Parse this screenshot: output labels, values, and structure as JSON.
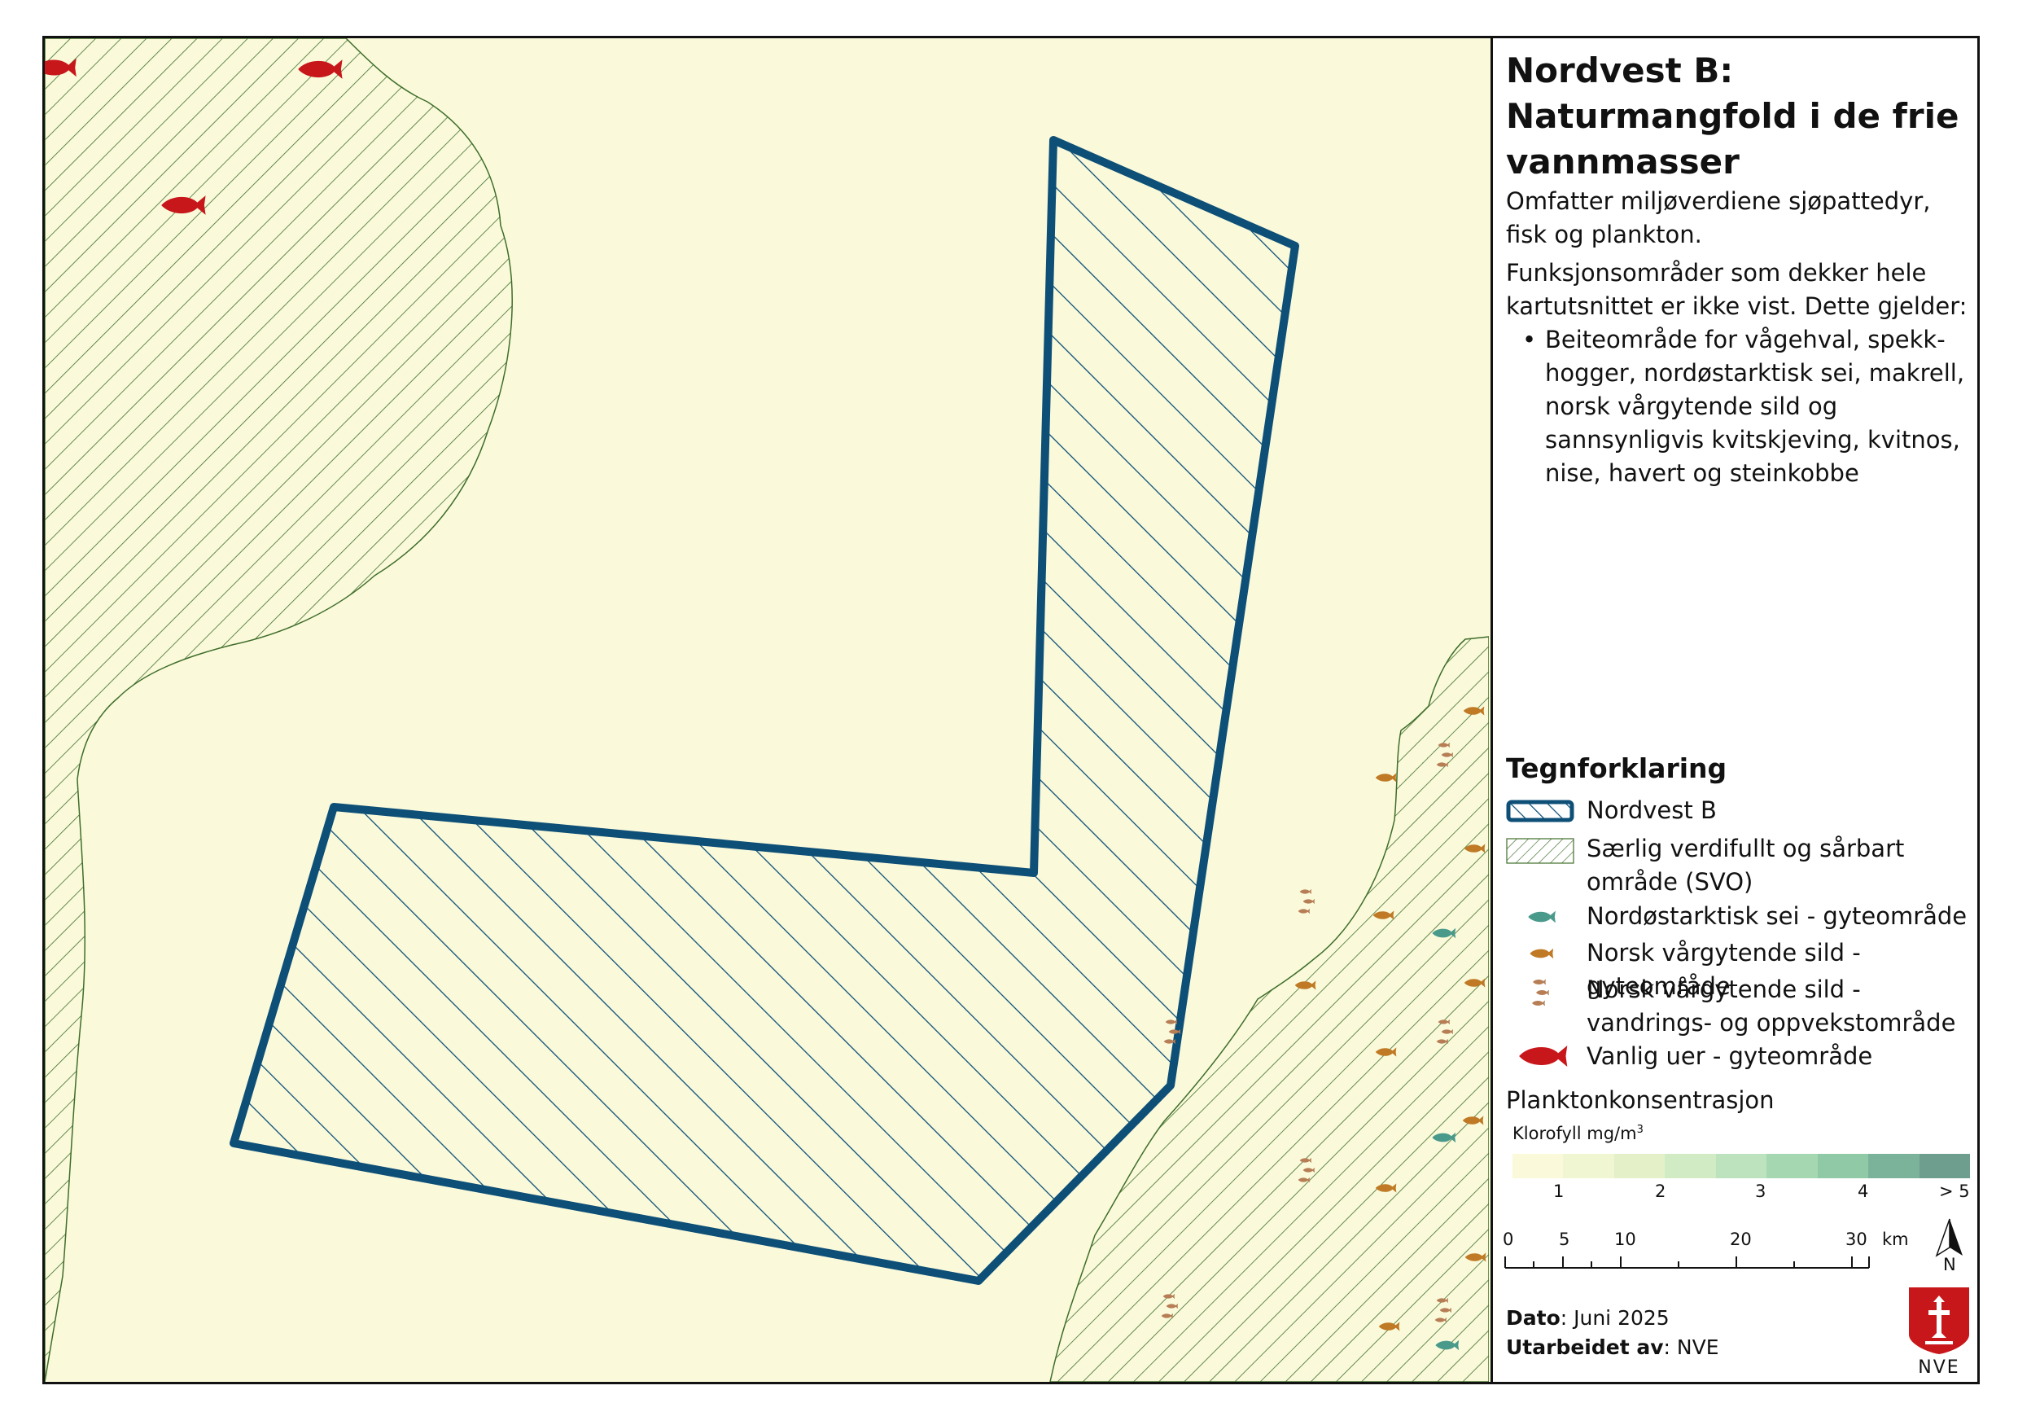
{
  "map": {
    "title": "Nordvest B: Naturmangfold i de frie vannmasser",
    "colors": {
      "sea": "#fafadb",
      "study_area_outline": "#0e4f77",
      "svo_hatch": "#3f6d29",
      "uer_fish": "#c8171b",
      "sei_fish": "#4a9a8c",
      "sild_fish": "#c07a25"
    }
  },
  "panel": {
    "title": "Nordvest B: Naturmangfold i de frie vannmasser",
    "description": "Omfatter miljøverdiene sjøpattedyr, fisk og plankton.",
    "note": "Funksjonsområder som dekker hele kartutsnittet er ikke vist. Dette gjelder:",
    "bullet": "Beiteområde for vågehval, spekk-hogger, nordøstarktisk sei, makrell, norsk vårgytende sild og sannsynligvis kvitskjeving, kvitnos, nise, havert og steinkobbe"
  },
  "legend": {
    "title": "Tegnforklaring",
    "items": [
      {
        "label": "Nordvest B",
        "icon": "study-area-hatched-box"
      },
      {
        "label": "Særlig verdifullt og sårbart område (SVO)",
        "icon": "svo-hatched-box"
      },
      {
        "label": "Nordøstarktisk sei - gyteområde",
        "icon": "teal-fish-icon"
      },
      {
        "label": "Norsk vårgytende sild - gyteområde",
        "icon": "orange-fish-icon"
      },
      {
        "label": "Norsk vårgytende sild - vandrings- og oppvekstområde",
        "icon": "small-fish-group-icon"
      },
      {
        "label": "Vanlig uer - gyteområde",
        "icon": "red-fish-icon"
      }
    ],
    "plankton": {
      "title": "Planktonkonsentrasjon",
      "unit_label": "Klorofyll mg/m",
      "unit_sup": "3",
      "tick_labels": [
        "1",
        "2",
        "3",
        "4",
        "> 5"
      ],
      "colors": [
        "#fafadb",
        "#f0f5d2",
        "#e3f0c8",
        "#d1ebc4",
        "#bce3bd",
        "#a5d8b1",
        "#8fc9a6",
        "#7ab39a",
        "#6d9e8e"
      ]
    },
    "scalebar": {
      "labels": [
        "0",
        "5",
        "10",
        "20",
        "30"
      ],
      "unit": "km"
    },
    "north_label": "N"
  },
  "footer": {
    "date_label": "Dato",
    "date_value": ": Juni 2025",
    "author_label": "Utarbeidet av",
    "author_value": ": NVE",
    "logo_text": "NVE"
  }
}
